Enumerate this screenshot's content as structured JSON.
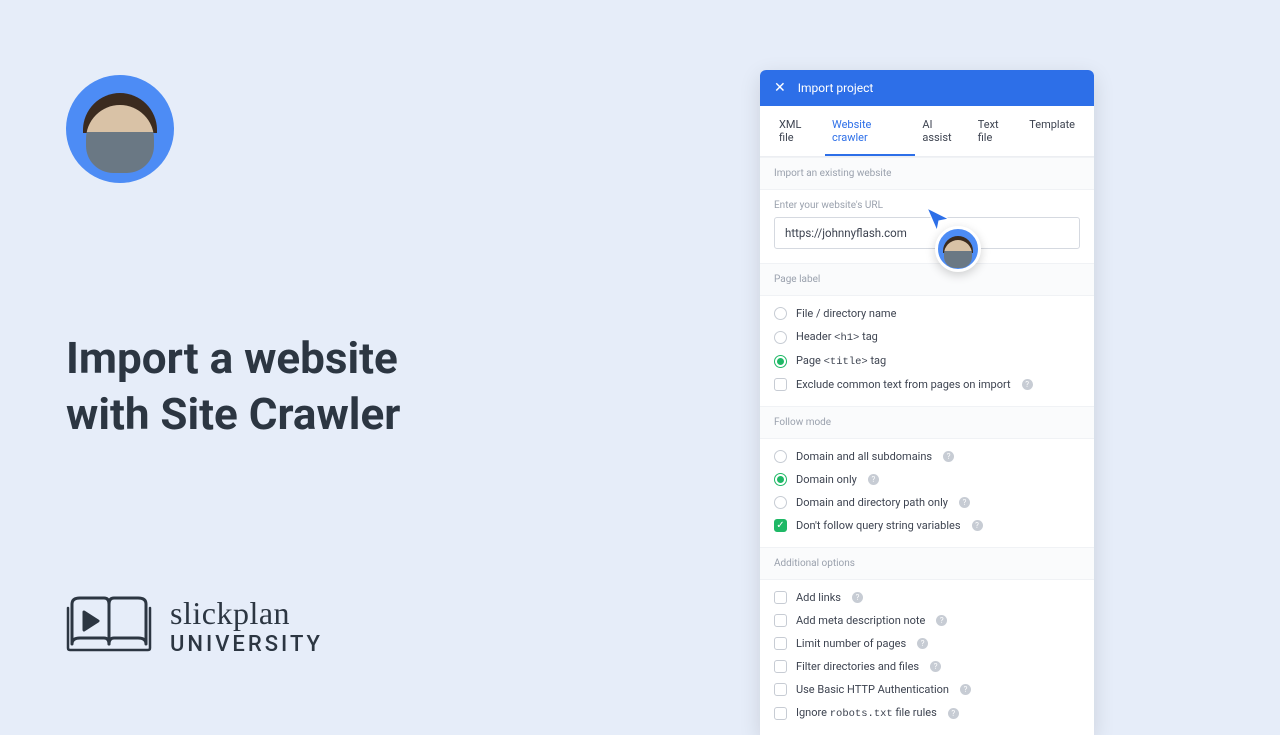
{
  "headline": "Import a website\nwith Site Crawler",
  "brand": {
    "script": "slickplan",
    "sub": "UNIVERSITY"
  },
  "panel": {
    "title": "Import project",
    "tabs": [
      "XML file",
      "Website crawler",
      "AI assist",
      "Text file",
      "Template"
    ],
    "active_tab": 1,
    "section_import": "Import an existing website",
    "url_label": "Enter your website's URL",
    "url_value": "https://johnnyflash.com",
    "section_page_label": "Page label",
    "page_label_opts": [
      {
        "label": "File / directory name",
        "type": "radio",
        "selected": false
      },
      {
        "label_pre": "Header ",
        "label_mono": "<h1>",
        "label_post": " tag",
        "type": "radio",
        "selected": false
      },
      {
        "label_pre": "Page ",
        "label_mono": "<title>",
        "label_post": " tag",
        "type": "radio",
        "selected": true
      },
      {
        "label": "Exclude common text from pages on import",
        "type": "check",
        "selected": false,
        "help": true
      }
    ],
    "section_follow": "Follow mode",
    "follow_opts": [
      {
        "label": "Domain and all subdomains",
        "type": "radio",
        "selected": false,
        "help": true
      },
      {
        "label": "Domain only",
        "type": "radio",
        "selected": true,
        "help": true
      },
      {
        "label": "Domain and directory path only",
        "type": "radio",
        "selected": false,
        "help": true
      },
      {
        "label": "Don't follow query string variables",
        "type": "check",
        "selected": true,
        "help": true
      }
    ],
    "section_additional": "Additional options",
    "additional_opts": [
      {
        "label": "Add links",
        "type": "check",
        "selected": false,
        "help": true
      },
      {
        "label": "Add meta description note",
        "type": "check",
        "selected": false,
        "help": true
      },
      {
        "label": "Limit number of pages",
        "type": "check",
        "selected": false,
        "help": true
      },
      {
        "label": "Filter directories and files",
        "type": "check",
        "selected": false,
        "help": true
      },
      {
        "label": "Use Basic HTTP Authentication",
        "type": "check",
        "selected": false,
        "help": true
      },
      {
        "label_pre": "Ignore ",
        "label_mono": "robots.txt",
        "label_post": " file rules",
        "type": "check",
        "selected": false,
        "help": true
      }
    ]
  }
}
